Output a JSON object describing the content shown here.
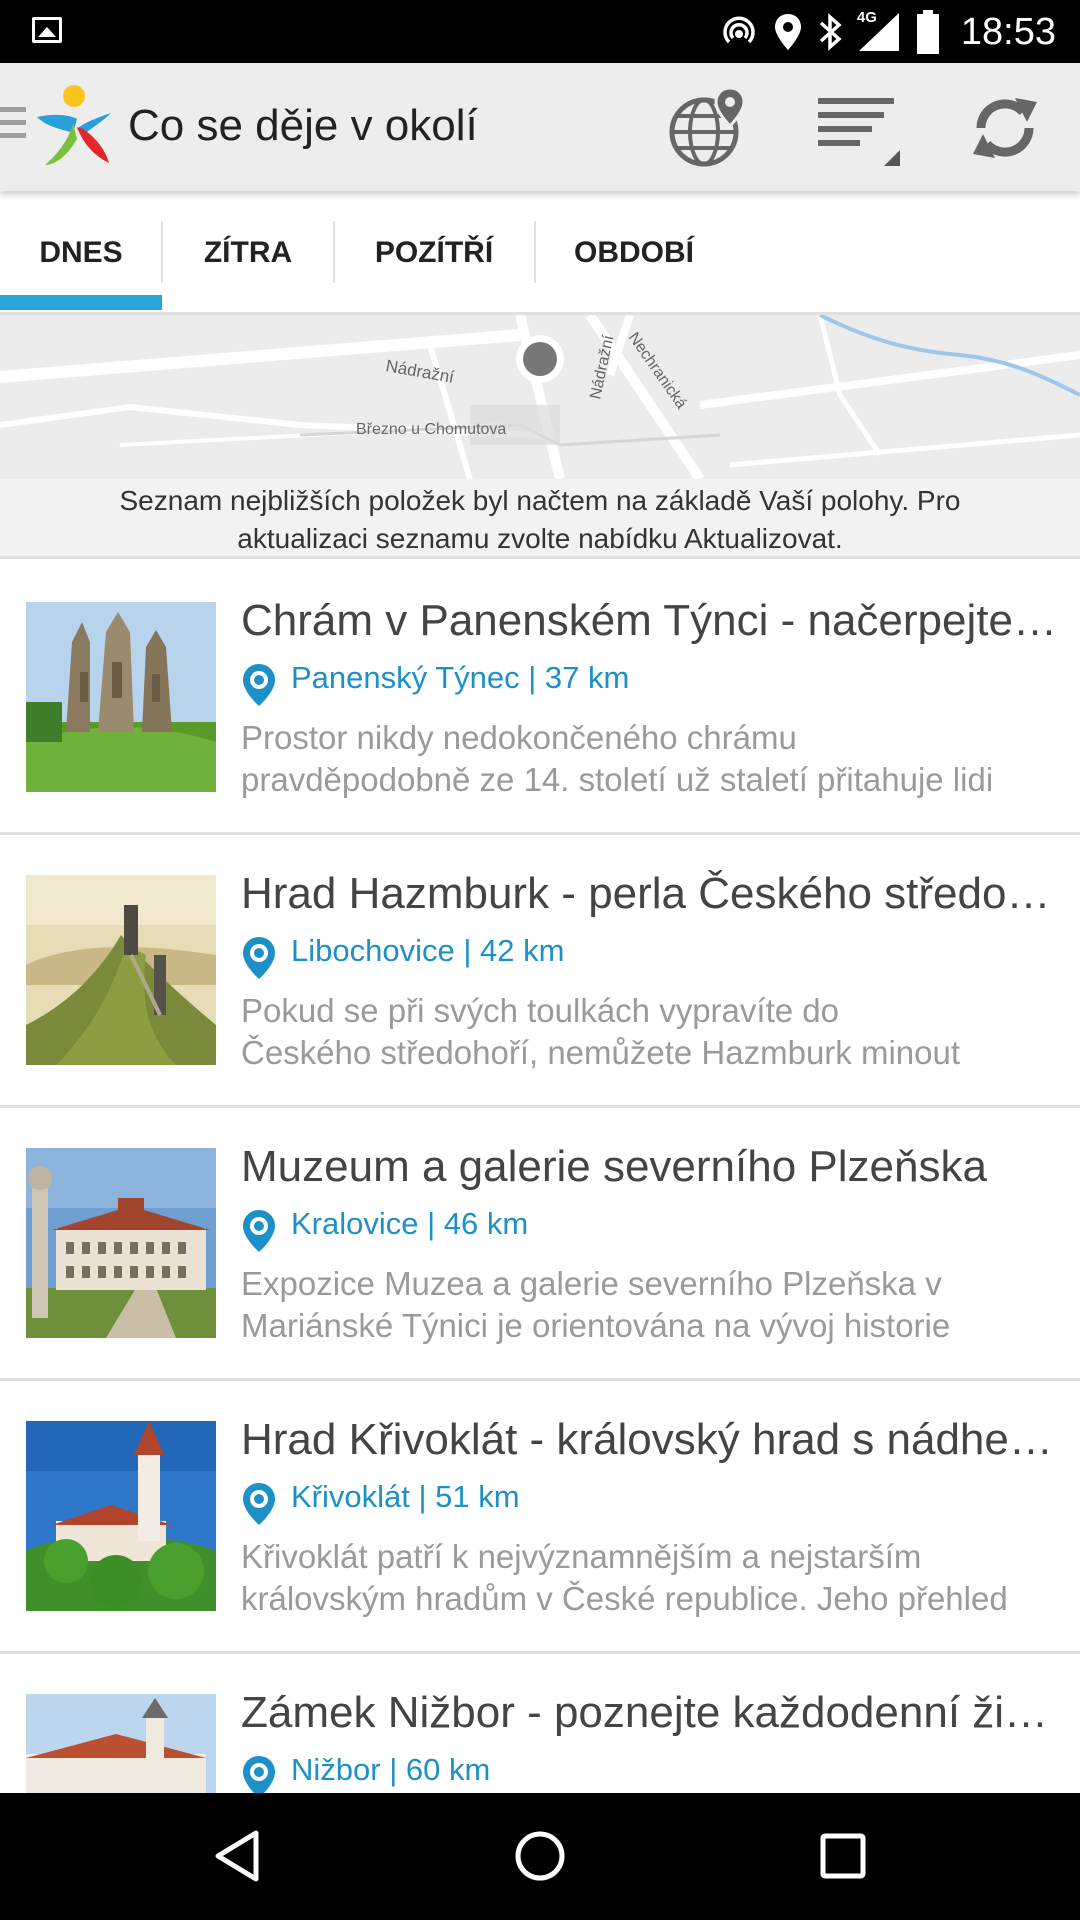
{
  "status_bar": {
    "time": "18:53",
    "network": "4G",
    "icons": [
      "gallery-icon",
      "hotspot-icon",
      "location-icon",
      "bluetooth-icon",
      "signal-icon",
      "battery-icon"
    ]
  },
  "app_bar": {
    "title": "Co se děje v okolí",
    "actions": [
      "globe-location-icon",
      "sort-icon",
      "refresh-icon"
    ]
  },
  "tabs": [
    {
      "label": "DNES",
      "selected": true
    },
    {
      "label": "ZÍTRA",
      "selected": false
    },
    {
      "label": "POZÍTŘÍ",
      "selected": false
    },
    {
      "label": "OBDOBÍ",
      "selected": false
    }
  ],
  "map": {
    "labels": [
      "Nádražní",
      "Nádražní",
      "Nechranická",
      "Březno u Chomutova"
    ]
  },
  "notice": {
    "line1": "Seznam nejbližších položek byl načtem na základě Vaší polohy. Pro",
    "line2": "aktualizaci seznamu zvolte nabídku Aktualizovat."
  },
  "items": [
    {
      "title": "Chrám v Panenském Týnci - načerpejte energii",
      "location": "Panenský Týnec | 37 km",
      "desc1": "Prostor nikdy nedokončeného chrámu",
      "desc2": "pravděpodobně ze 14. století už staletí přitahuje lidi"
    },
    {
      "title": "Hrad Hazmburk - perla Českého středohoří",
      "location": "Libochovice | 42 km",
      "desc1": "Pokud se při svých toulkách vypravíte do",
      "desc2": "Českého středohoří, nemůžete Hazmburk minout"
    },
    {
      "title": "Muzeum a galerie severního Plzeňska",
      "location": "Kralovice | 46 km",
      "desc1": "Expozice Muzea a galerie severního Plzeňska v",
      "desc2": "Mariánské Týnici je orientována na vývoj historie"
    },
    {
      "title": "Hrad Křivoklát - královský hrad s nádherou",
      "location": "Křivoklát | 51 km",
      "desc1": "Křivoklát patří k nejvýznamnějším a nejstarším",
      "desc2": "královským hradům v České republice. Jeho přehled"
    },
    {
      "title": "Zámek Nižbor - poznejte každodenní život",
      "location": "Nižbor | 60 km",
      "desc1": "",
      "desc2": ""
    }
  ],
  "nav_bar": {
    "buttons": [
      "back-icon",
      "home-icon",
      "recents-icon"
    ]
  }
}
